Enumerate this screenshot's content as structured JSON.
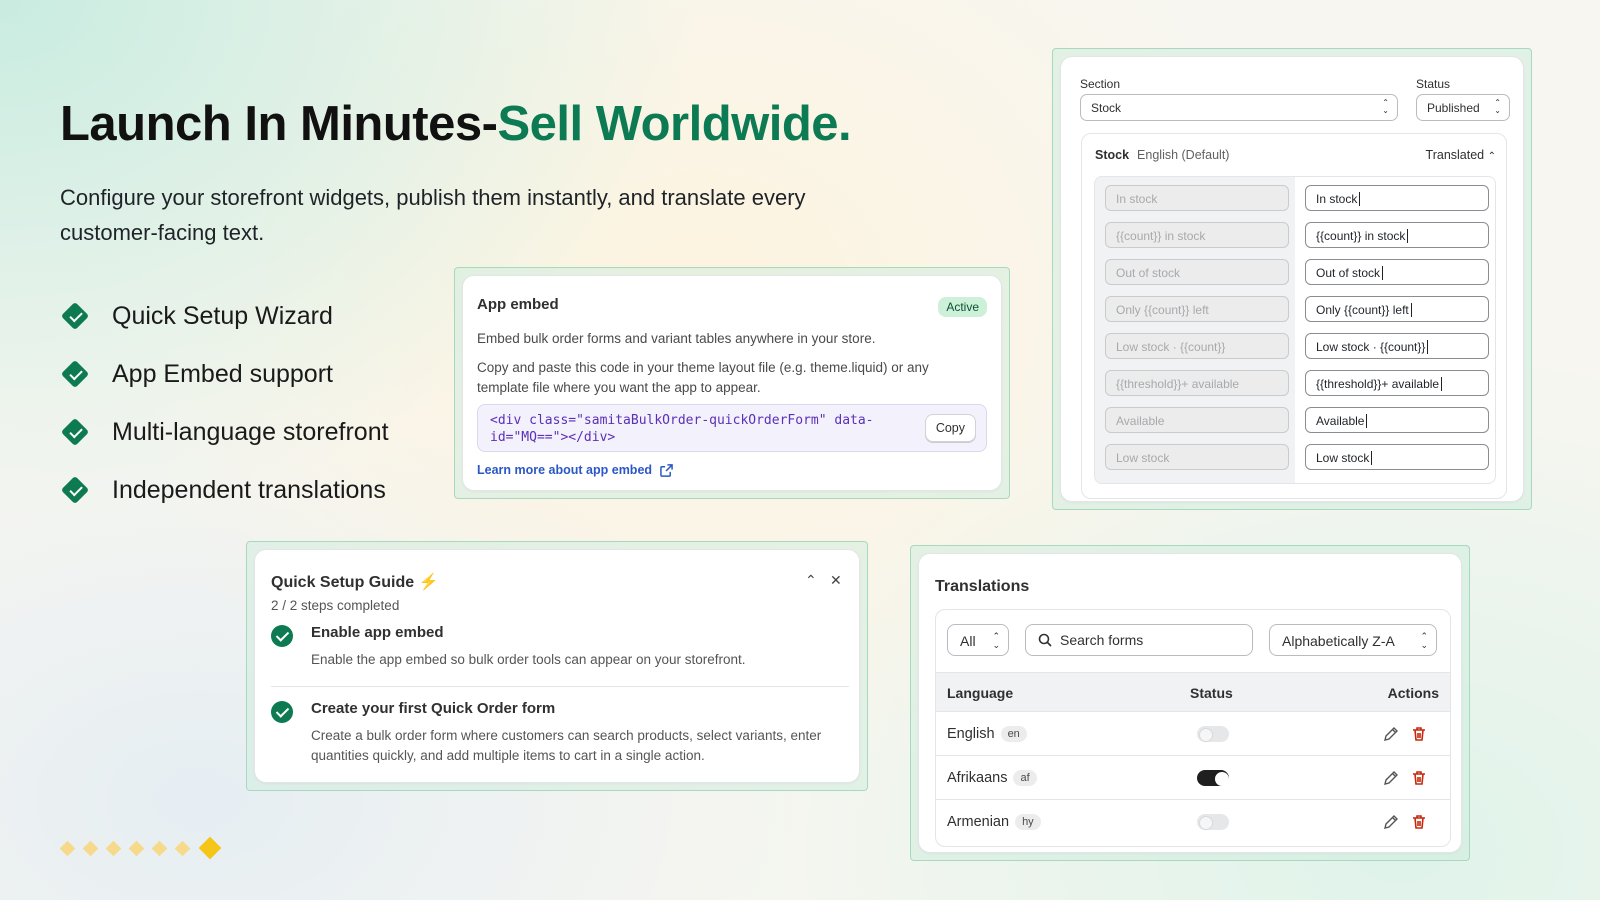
{
  "hero": {
    "title_main": "Launch In Minutes-",
    "title_accent": "Sell Worldwide.",
    "subtitle": "Configure your storefront widgets, publish them instantly, and translate every customer-facing text.",
    "features": [
      "Quick Setup Wizard",
      "App Embed support",
      "Multi-language storefront",
      "Independent translations"
    ]
  },
  "app_embed": {
    "title": "App embed",
    "badge": "Active",
    "desc1": "Embed bulk order forms and variant tables anywhere in your store.",
    "desc2": "Copy and paste this code in your theme layout file (e.g. theme.liquid) or any template file where you want the app to appear.",
    "code": "<div class=\"samitaBulkOrder-quickOrderForm\" data-id=\"MQ==\"></div>",
    "copy_label": "Copy",
    "link": "Learn more about app embed"
  },
  "stock_editor": {
    "section_label": "Section",
    "section_value": "Stock",
    "status_label": "Status",
    "status_value": "Published",
    "panel_name": "Stock",
    "panel_lang": "English (Default)",
    "panel_state": "Translated",
    "rows": [
      {
        "source": "In stock",
        "translation": "In stock"
      },
      {
        "source": "{{count}} in stock",
        "translation": "{{count}} in stock"
      },
      {
        "source": "Out of stock",
        "translation": "Out of stock"
      },
      {
        "source": "Only {{count}} left",
        "translation": "Only {{count}} left"
      },
      {
        "source": "Low stock · {{count}}",
        "translation": "Low stock · {{count}}"
      },
      {
        "source": "{{threshold}}+ available",
        "translation": "{{threshold}}+ available"
      },
      {
        "source": "Available",
        "translation": "Available"
      },
      {
        "source": "Low stock",
        "translation": "Low stock"
      }
    ]
  },
  "setup_guide": {
    "title": "Quick Setup Guide",
    "title_emoji": "⚡",
    "progress": "2 / 2 steps completed",
    "steps": [
      {
        "title": "Enable app embed",
        "desc": "Enable the app embed so bulk order tools can appear on your storefront."
      },
      {
        "title": "Create your first Quick Order form",
        "desc": "Create a bulk order form where customers can search products, select variants, enter quantities quickly, and add multiple items to cart in a single action."
      }
    ]
  },
  "translations": {
    "title": "Translations",
    "filter_value": "All",
    "search_placeholder": "Search forms",
    "sort_value": "Alphabetically Z-A",
    "columns": {
      "language": "Language",
      "status": "Status",
      "actions": "Actions"
    },
    "rows": [
      {
        "language": "English",
        "code": "en",
        "enabled": false
      },
      {
        "language": "Afrikaans",
        "code": "af",
        "enabled": true
      },
      {
        "language": "Armenian",
        "code": "hy",
        "enabled": false
      }
    ]
  },
  "colors": {
    "brand_green": "#0c7a52",
    "delete_red": "#c5280c",
    "dot_gold": "#f5c518"
  },
  "pager": {
    "dot_count": 7,
    "active_index": 6
  }
}
